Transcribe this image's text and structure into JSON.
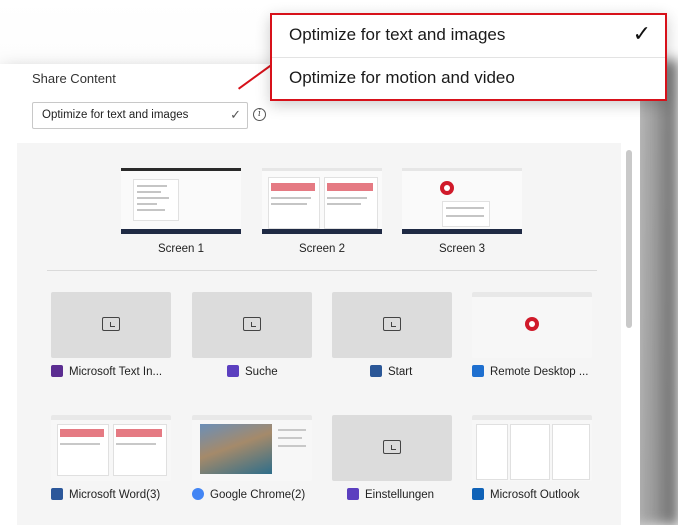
{
  "panel": {
    "title": "Share Content",
    "dropdown_value": "Optimize for text and images",
    "dropdown_check": "✓",
    "info_glyph": "i"
  },
  "menu": {
    "items": [
      {
        "label": "Optimize for text and images",
        "selected": true,
        "check": "✓"
      },
      {
        "label": "Optimize for motion and video",
        "selected": false
      }
    ]
  },
  "screens": [
    {
      "label": "Screen 1"
    },
    {
      "label": "Screen 2"
    },
    {
      "label": "Screen 3"
    }
  ],
  "windows": [
    {
      "label": "Microsoft Text In...",
      "icon": "text-input-app-icon",
      "color": "#5b2d91"
    },
    {
      "label": "Suche",
      "icon": "search-app-icon",
      "color": "#5b3fbf"
    },
    {
      "label": "Start",
      "icon": "start-app-icon",
      "color": "#2b5797"
    },
    {
      "label": "Remote Desktop ...",
      "icon": "remote-desktop-icon",
      "color": "#1e6fcf"
    },
    {
      "label": "Microsoft Word(3)",
      "icon": "word-icon",
      "color": "#2b579a"
    },
    {
      "label": "Google Chrome(2)",
      "icon": "chrome-icon",
      "color": "#4285f4"
    },
    {
      "label": "Einstellungen",
      "icon": "settings-icon",
      "color": "#5b3fbf"
    },
    {
      "label": "Microsoft Outlook",
      "icon": "outlook-icon",
      "color": "#0f62b7"
    }
  ],
  "colors": {
    "accent_red": "#d7111a",
    "panel_bg": "#f5f5f5"
  }
}
